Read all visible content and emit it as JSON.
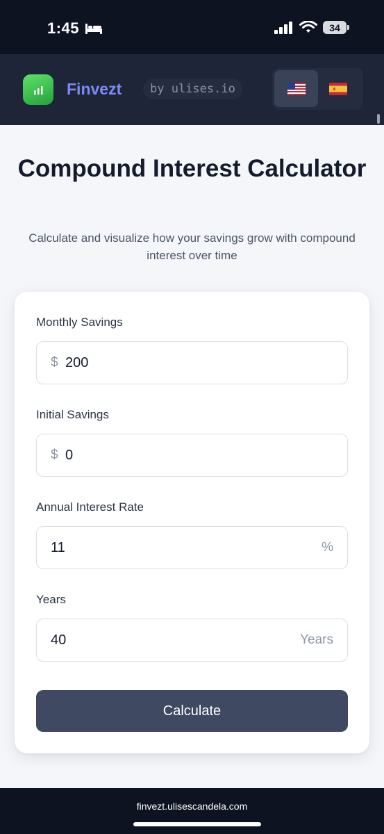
{
  "status_bar": {
    "time": "1:45",
    "battery": "34"
  },
  "header": {
    "brand": "Finvezt",
    "byline": "by ulises.io",
    "languages": [
      {
        "code": "en",
        "flag": "🇺🇸",
        "active": true
      },
      {
        "code": "es",
        "flag": "🇪🇸",
        "active": false
      }
    ]
  },
  "main": {
    "title": "Compound Interest Calculator",
    "subtitle": "Calculate and visualize how your savings grow with compound interest over time"
  },
  "form": {
    "monthly_savings": {
      "label": "Monthly Savings",
      "prefix": "$",
      "value": "200"
    },
    "initial_savings": {
      "label": "Initial Savings",
      "prefix": "$",
      "value": "0"
    },
    "interest_rate": {
      "label": "Annual Interest Rate",
      "value": "11",
      "suffix": "%"
    },
    "years": {
      "label": "Years",
      "value": "40",
      "suffix": "Years"
    },
    "calculate_label": "Calculate"
  },
  "browser": {
    "url": "finvezt.ulisescandela.com"
  },
  "colors": {
    "header_bg": "#1e2538",
    "brand_accent": "#7c8cf5",
    "logo_green": "#3cc24d",
    "button_bg": "#3f4961"
  }
}
